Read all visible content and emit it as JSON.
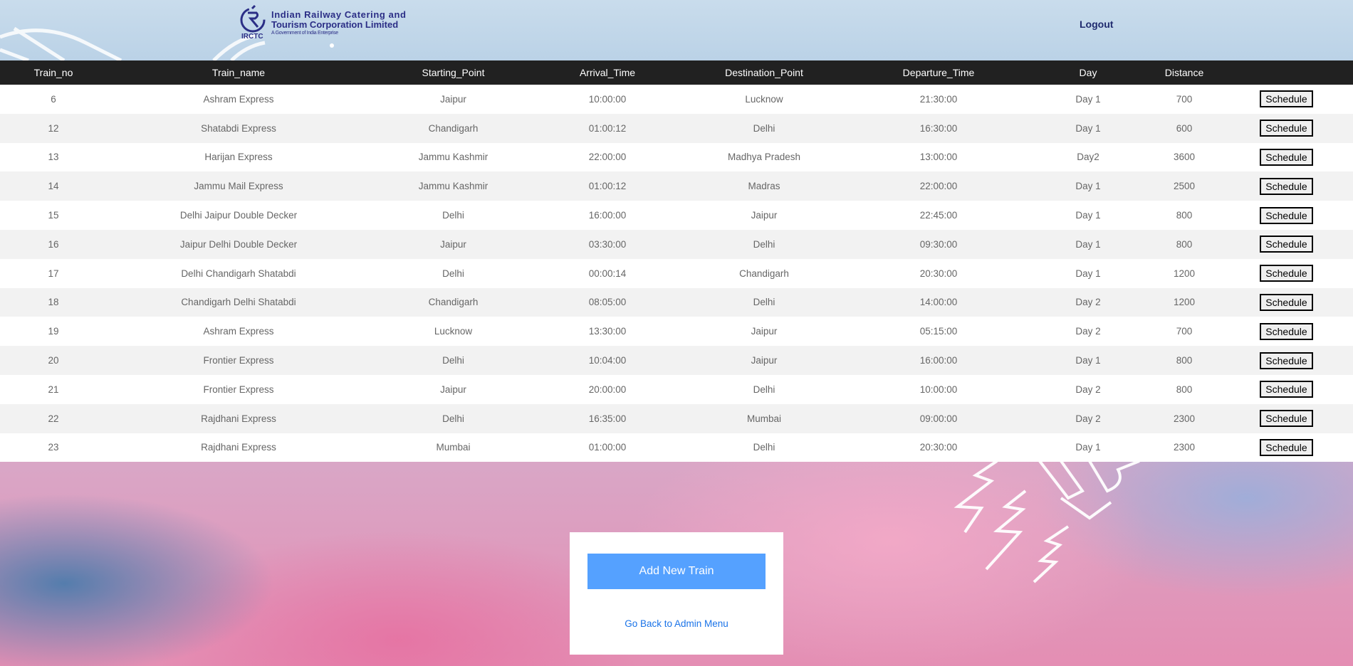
{
  "header": {
    "logo": {
      "line1": "Indian Railway Catering and",
      "line2": "Tourism Corporation Limited",
      "line3": "A Government of India Enterprise",
      "abbr": "IRCTC"
    },
    "logout_label": "Logout"
  },
  "table": {
    "columns": [
      "Train_no",
      "Train_name",
      "Starting_Point",
      "Arrival_Time",
      "Destination_Point",
      "Departure_Time",
      "Day",
      "Distance",
      ""
    ],
    "rows": [
      {
        "no": "6",
        "name": "Ashram Express",
        "start": "Jaipur",
        "arrival": "10:00:00",
        "dest": "Lucknow",
        "departure": "21:30:00",
        "day": "Day 1",
        "distance": "700",
        "action": "Schedule"
      },
      {
        "no": "12",
        "name": "Shatabdi Express",
        "start": "Chandigarh",
        "arrival": "01:00:12",
        "dest": "Delhi",
        "departure": "16:30:00",
        "day": "Day 1",
        "distance": "600",
        "action": "Schedule"
      },
      {
        "no": "13",
        "name": "Harijan Express",
        "start": "Jammu Kashmir",
        "arrival": "22:00:00",
        "dest": "Madhya Pradesh",
        "departure": "13:00:00",
        "day": "Day2",
        "distance": "3600",
        "action": "Schedule"
      },
      {
        "no": "14",
        "name": "Jammu Mail Express",
        "start": "Jammu Kashmir",
        "arrival": "01:00:12",
        "dest": "Madras",
        "departure": "22:00:00",
        "day": "Day 1",
        "distance": "2500",
        "action": "Schedule"
      },
      {
        "no": "15",
        "name": "Delhi Jaipur Double Decker",
        "start": "Delhi",
        "arrival": "16:00:00",
        "dest": "Jaipur",
        "departure": "22:45:00",
        "day": "Day 1",
        "distance": "800",
        "action": "Schedule"
      },
      {
        "no": "16",
        "name": "Jaipur Delhi Double Decker",
        "start": "Jaipur",
        "arrival": "03:30:00",
        "dest": "Delhi",
        "departure": "09:30:00",
        "day": "Day 1",
        "distance": "800",
        "action": "Schedule"
      },
      {
        "no": "17",
        "name": "Delhi Chandigarh Shatabdi",
        "start": "Delhi",
        "arrival": "00:00:14",
        "dest": "Chandigarh",
        "departure": "20:30:00",
        "day": "Day 1",
        "distance": "1200",
        "action": "Schedule"
      },
      {
        "no": "18",
        "name": "Chandigarh Delhi Shatabdi",
        "start": "Chandigarh",
        "arrival": "08:05:00",
        "dest": "Delhi",
        "departure": "14:00:00",
        "day": "Day 2",
        "distance": "1200",
        "action": "Schedule"
      },
      {
        "no": "19",
        "name": "Ashram Express",
        "start": "Lucknow",
        "arrival": "13:30:00",
        "dest": "Jaipur",
        "departure": "05:15:00",
        "day": "Day 2",
        "distance": "700",
        "action": "Schedule"
      },
      {
        "no": "20",
        "name": "Frontier Express",
        "start": "Delhi",
        "arrival": "10:04:00",
        "dest": "Jaipur",
        "departure": "16:00:00",
        "day": "Day 1",
        "distance": "800",
        "action": "Schedule"
      },
      {
        "no": "21",
        "name": "Frontier Express",
        "start": "Jaipur",
        "arrival": "20:00:00",
        "dest": "Delhi",
        "departure": "10:00:00",
        "day": "Day 2",
        "distance": "800",
        "action": "Schedule"
      },
      {
        "no": "22",
        "name": "Rajdhani Express",
        "start": "Delhi",
        "arrival": "16:35:00",
        "dest": "Mumbai",
        "departure": "09:00:00",
        "day": "Day 2",
        "distance": "2300",
        "action": "Schedule"
      },
      {
        "no": "23",
        "name": "Rajdhani Express",
        "start": "Mumbai",
        "arrival": "01:00:00",
        "dest": "Delhi",
        "departure": "20:30:00",
        "day": "Day 1",
        "distance": "2300",
        "action": "Schedule"
      }
    ]
  },
  "panel": {
    "add_button_label": "Add New Train",
    "back_link_label": "Go Back to Admin Menu"
  },
  "colors": {
    "header_row_bg": "#212121",
    "add_button_bg": "#55a1ff",
    "link_color": "#1a73e8",
    "logo_color": "#2b2e86"
  }
}
